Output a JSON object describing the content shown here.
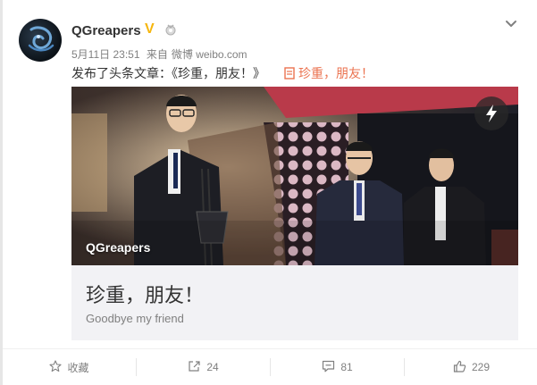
{
  "post": {
    "username": "QGreapers",
    "verified_mark": "V",
    "timestamp": "5月11日 23:51",
    "source_prefix": "来自",
    "source": "微博 weibo.com",
    "text": "发布了头条文章：《珍重，朋友！》",
    "article_link": "珍重，朋友！"
  },
  "card": {
    "image_caption": "QGreapers",
    "title": "珍重，朋友！",
    "description": "Goodbye my friend"
  },
  "actions": {
    "favorite": "收藏",
    "repost_count": "24",
    "comment_count": "81",
    "like_count": "229"
  },
  "colors": {
    "link": "#eb7350",
    "verified": "#f6b60d",
    "muted_text": "#808080"
  },
  "icons": {
    "more": "chevron-down-icon",
    "medal": "medal-icon",
    "article": "document-icon",
    "flash": "lightning-icon",
    "favorite": "star-icon",
    "repost": "share-icon",
    "comment": "comment-icon",
    "like": "thumbs-up-icon"
  }
}
